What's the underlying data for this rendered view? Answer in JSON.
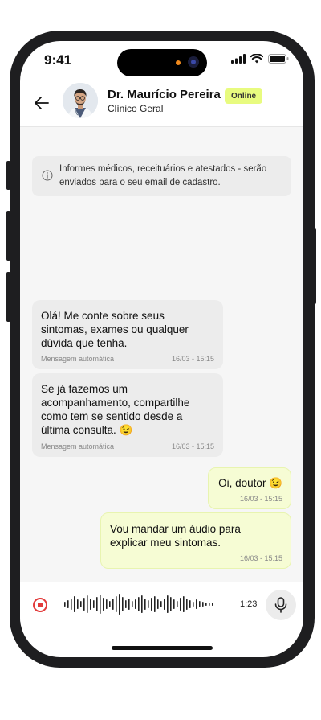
{
  "status_bar": {
    "time": "9:41"
  },
  "header": {
    "doctor_name": "Dr. Maurício Pereira",
    "specialty": "Clínico Geral",
    "status_badge": "Online"
  },
  "notice": {
    "text": "Informes médicos, receituários e atestados - serão enviados para o seu email de cadastro."
  },
  "messages": [
    {
      "text": "Olá! Me conte sobre seus sintomas, exames ou qualquer dúvida que tenha.",
      "label": "Mensagem automática",
      "time": "16/03 - 15:15"
    },
    {
      "text": "Se já fazemos um acompanhamento, compartilhe como tem se sentido desde a última consulta. 😉",
      "label": "Mensagem automática",
      "time": "16/03 - 15:15"
    },
    {
      "text": "Oi, doutor 😉",
      "time": "16/03 - 15:15"
    },
    {
      "text": "Vou mandar um áudio para explicar meu sintomas.",
      "time": "16/03 - 15:15"
    }
  ],
  "recorder": {
    "duration": "1:23"
  },
  "colors": {
    "badge": "#e8fb7f",
    "outgoing_bubble": "#f6fcd4",
    "record": "#e23a3a"
  },
  "icons": [
    "back-arrow-icon",
    "info-icon",
    "stop-record-icon",
    "waveform-icon",
    "microphone-icon",
    "signal-icon",
    "wifi-icon",
    "battery-icon"
  ]
}
